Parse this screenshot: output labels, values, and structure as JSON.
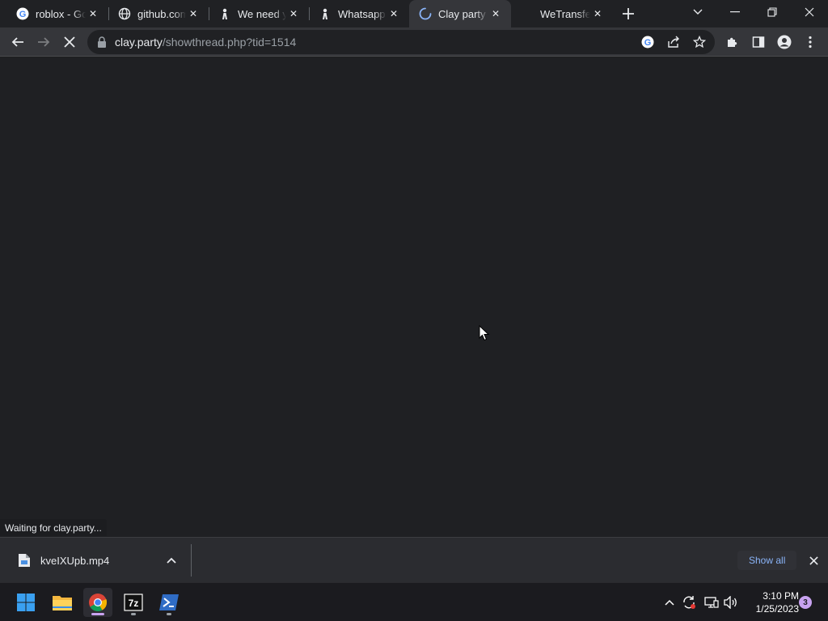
{
  "browser": {
    "tabs": [
      {
        "title": "roblox - Google Search",
        "favicon": "google-icon",
        "active": false
      },
      {
        "title": "github.com",
        "favicon": "globe-icon",
        "active": false
      },
      {
        "title": "We need your help",
        "favicon": "figure-icon",
        "active": false
      },
      {
        "title": "Whatsapp",
        "favicon": "figure-icon",
        "active": false
      },
      {
        "title": "Clay party",
        "favicon": "loading-spinner-icon",
        "active": true
      },
      {
        "title": "WeTransfer",
        "favicon": "none",
        "active": false
      }
    ],
    "new_tab_icon": "plus-icon",
    "window_controls": [
      "tab-search-icon",
      "minimize-icon",
      "restore-icon",
      "close-icon"
    ],
    "address": {
      "host": "clay.party",
      "path": "/showthread.php?tid=1514"
    },
    "status_text": "Waiting for clay.party..."
  },
  "download_shelf": {
    "items": [
      {
        "filename": "kveIXUpb.mp4",
        "icon": "file-icon"
      }
    ],
    "show_all_label": "Show all"
  },
  "taskbar": {
    "apps": [
      "windows-start-icon",
      "file-explorer-icon",
      "chrome-icon",
      "7zip-icon",
      "powershell-icon"
    ],
    "clock_time": "3:10 PM",
    "clock_date": "1/25/2023",
    "notification_count": "3"
  },
  "colors": {
    "tabstrip_bg": "#202124",
    "toolbar_bg": "#35363a",
    "content_bg": "#1f2023",
    "link_blue": "#8ab4f8"
  }
}
